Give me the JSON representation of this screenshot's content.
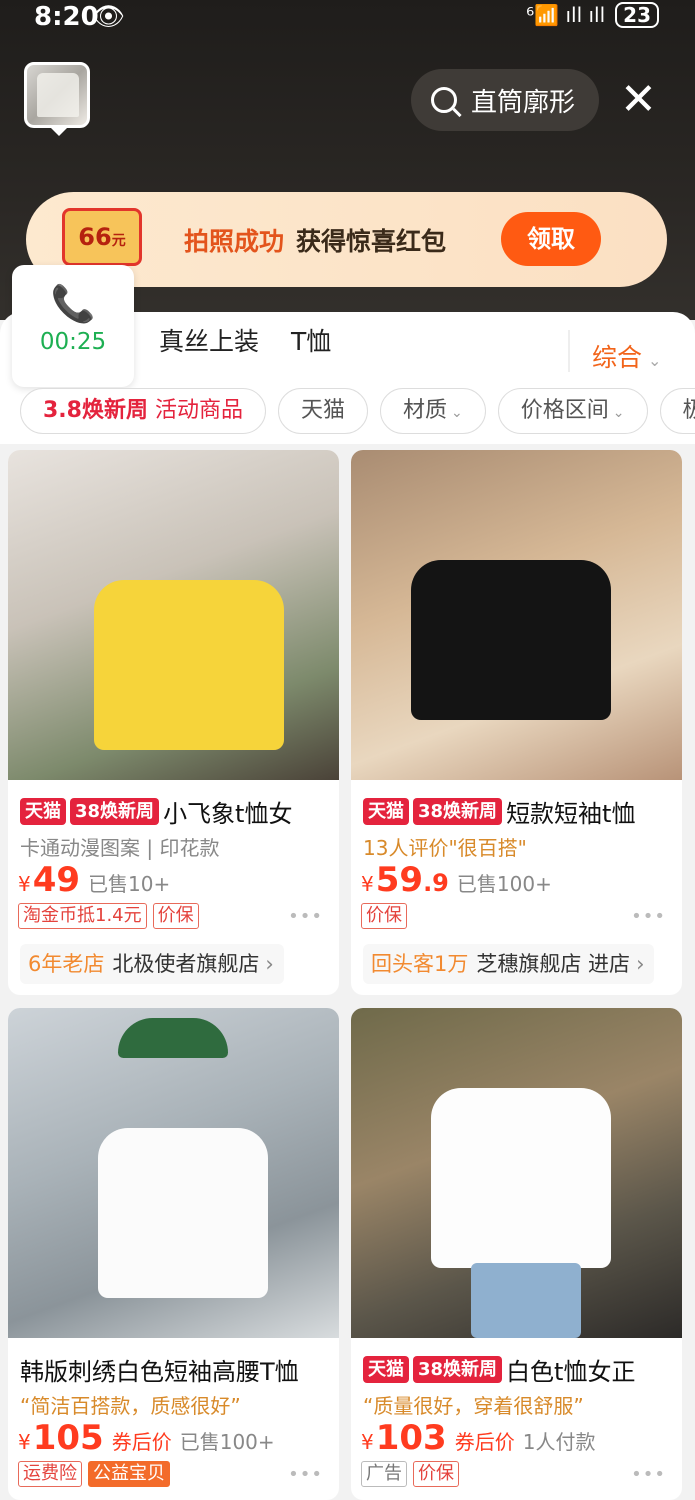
{
  "status": {
    "time": "8:20",
    "battery": "23",
    "signal": "⁶📶 ıll ıll"
  },
  "search": {
    "query": "直筒廓形"
  },
  "promo": {
    "coupon_value": "66",
    "coupon_unit": "元",
    "text_highlight": "拍照成功",
    "text_main": "获得惊喜红包",
    "button": "领取"
  },
  "call": {
    "timer": "00:25"
  },
  "categories": [
    "真丝上装",
    "T恤"
  ],
  "sort": {
    "label": "综合"
  },
  "chips": [
    {
      "bold": "3.8焕新周",
      "label": "活动商品"
    },
    {
      "label": "天猫"
    },
    {
      "label": "材质"
    },
    {
      "label": "价格区间"
    },
    {
      "label": "极"
    }
  ],
  "products": [
    {
      "tags": [
        "天猫",
        "38焕新周"
      ],
      "title": "小飞象t恤女",
      "subtitle": "卡通动漫图案 | 印花款",
      "price": "49",
      "price_decimal": "",
      "sold": "已售10+",
      "badges": [
        "淘金币抵1.4元",
        "价保"
      ],
      "shop_highlight": "6年老店",
      "shop_name": "北极使者旗舰店"
    },
    {
      "tags": [
        "天猫",
        "38焕新周"
      ],
      "title": "短款短袖t恤",
      "subtitle": "13人评价\"很百搭\"",
      "price": "59",
      "price_decimal": ".9",
      "sold": "已售100+",
      "badges": [
        "价保"
      ],
      "shop_highlight": "回头客1万",
      "shop_name": "芝穗旗舰店 进店"
    },
    {
      "tags": [],
      "title": "韩版刺绣白色短袖高腰T恤",
      "subtitle": "“简洁百搭款，质感很好”",
      "price": "105",
      "price_decimal": "",
      "after_label": "券后价",
      "sold": "已售100+",
      "badges": [
        "运费险",
        "公益宝贝"
      ]
    },
    {
      "tags": [
        "天猫",
        "38焕新周"
      ],
      "title": "白色t恤女正",
      "subtitle": "“质量很好，穿着很舒服”",
      "price": "103",
      "price_decimal": "",
      "after_label": "券后价",
      "sold": "1人付款",
      "badges": [
        "广告",
        "价保"
      ]
    }
  ],
  "currency": "¥",
  "more": "•••",
  "icons": {
    "eye": "👁",
    "close": "✕",
    "phone": "📞",
    "chevron": "⌄",
    "arrow": "›"
  }
}
